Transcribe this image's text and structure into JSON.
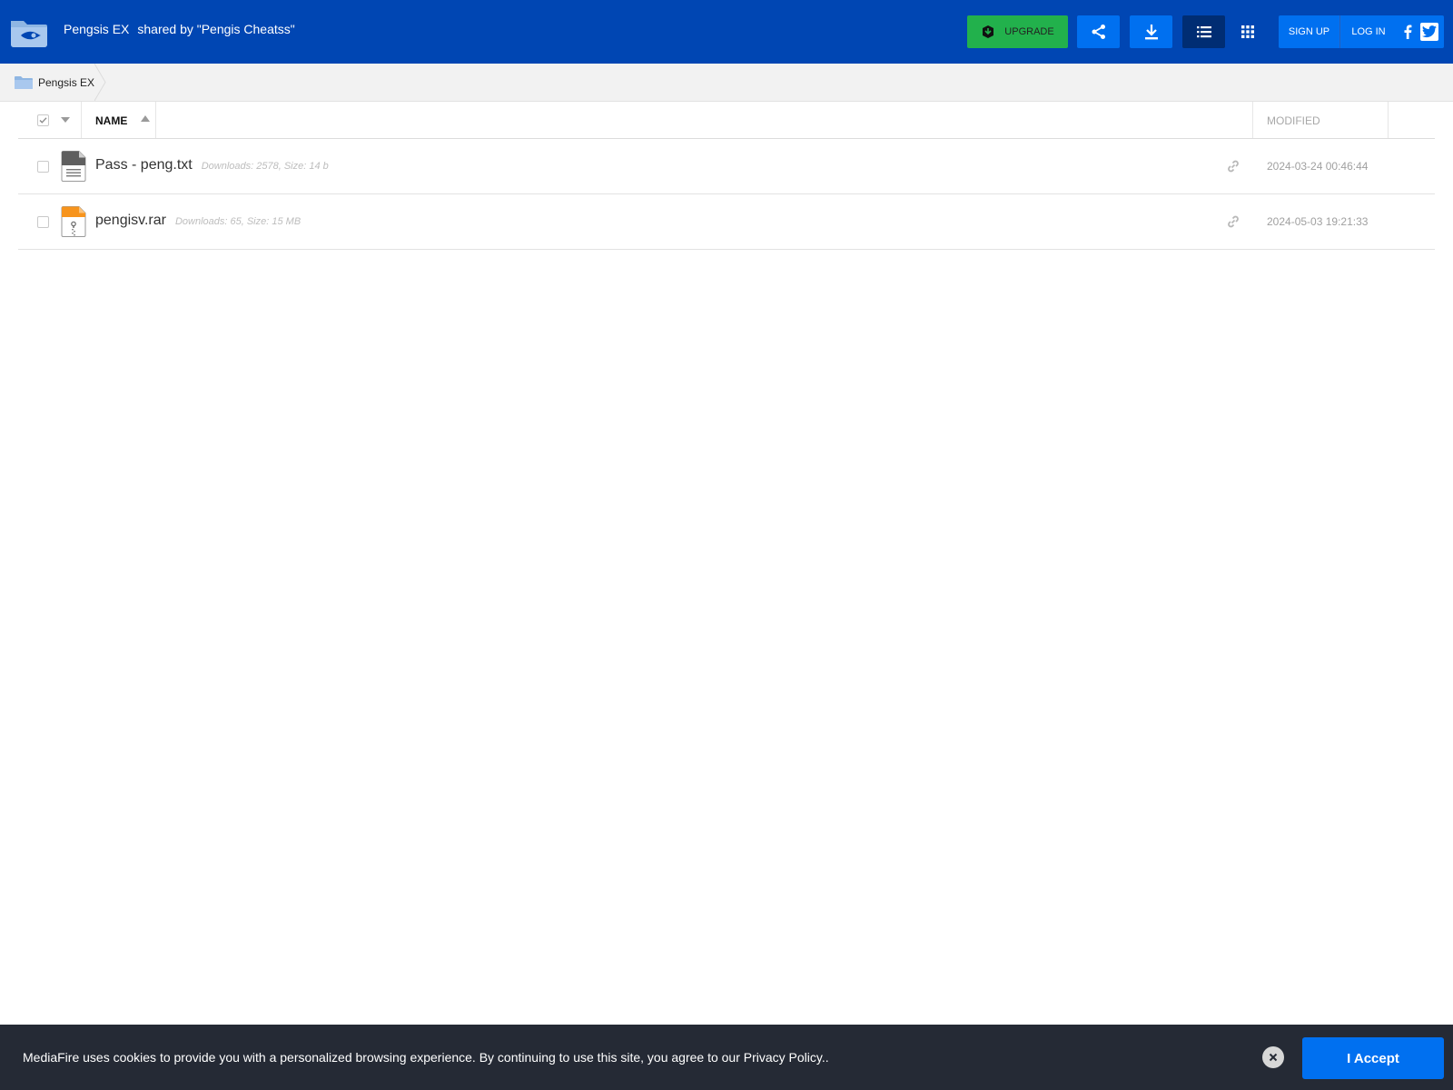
{
  "header": {
    "folder_name": "Pengsis EX",
    "shared_by": "shared by \"Pengis Cheatss\"",
    "upgrade_label": "UPGRADE",
    "signup_label": "SIGN UP",
    "login_label": "LOG IN",
    "brand_color": "#0046b3",
    "accent_color": "#0070f0",
    "upgrade_color": "#22b14c"
  },
  "breadcrumb": {
    "items": [
      {
        "label": "Pengsis EX",
        "icon": "folder-icon"
      }
    ]
  },
  "table": {
    "columns": {
      "name": "NAME",
      "modified": "MODIFIED"
    },
    "sort": {
      "column": "name",
      "direction": "ascending"
    },
    "rows": [
      {
        "name": "Pass - peng.txt",
        "meta": "Downloads: 2578, Size: 14 b",
        "modified": "2024-03-24 00:46:44",
        "icon": "text-file-icon"
      },
      {
        "name": "pengisv.rar",
        "meta": "Downloads: 65, Size: 15 MB",
        "modified": "2024-05-03 19:21:33",
        "icon": "archive-file-icon"
      }
    ]
  },
  "cookie_banner": {
    "text": "MediaFire uses cookies to provide you with a personalized browsing experience. By continuing to use this site, you agree to our Privacy Policy..",
    "accept_label": "I Accept"
  }
}
